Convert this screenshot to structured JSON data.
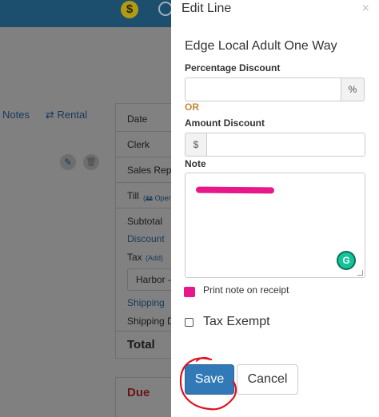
{
  "header": {
    "coin_symbol": "$"
  },
  "background": {
    "notes_link": "Notes",
    "rental_link": "⇄ Rental",
    "summary": {
      "date": "Date",
      "clerk": "Clerk",
      "sales_rep": "Sales Rep",
      "till": "Till",
      "till_open": "(🖴 Open",
      "subtotal": "Subtotal",
      "discount": "Discount",
      "tax": "Tax",
      "tax_add": "(Add)",
      "tax_select": "Harbor -",
      "shipping": "Shipping",
      "shipping_d": "Shipping D",
      "total": "Total",
      "due": "Due"
    }
  },
  "modal": {
    "title": "Edit Line",
    "close": "×",
    "item_name": "Edge Local Adult One Way",
    "percentage_label": "Percentage Discount",
    "percentage_value": "",
    "percentage_addon": "%",
    "or_text": "OR",
    "amount_label": "Amount Discount",
    "amount_addon": "$",
    "amount_value": "",
    "note_label": "Note",
    "grammarly_letter": "G",
    "print_note_label": "Print note on receipt",
    "print_note_checked": true,
    "tax_exempt_label": "Tax Exempt",
    "tax_exempt_checked": false,
    "save_label": "Save",
    "cancel_label": "Cancel"
  },
  "colors": {
    "header_bg": "#1c4f6e",
    "primary": "#3279b7",
    "or_accent": "#c08a3a",
    "highlight_pink": "#e8178a",
    "annotation_red": "#e0101e"
  }
}
